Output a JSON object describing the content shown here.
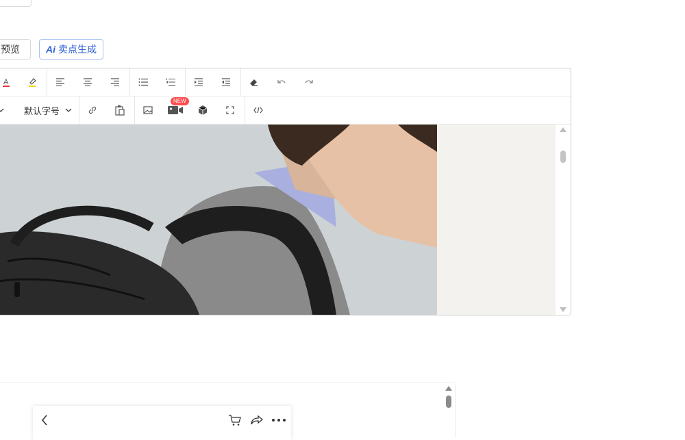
{
  "buttons": {
    "preview_label": "预览",
    "ai_label": "卖点生成",
    "ai_mark": "Ai"
  },
  "toolbar": {
    "font_size_label": "默认字号",
    "new_badge": "NEW",
    "row1_icons": [
      "text-color-icon",
      "highlight-color-icon",
      "align-left-icon",
      "align-center-icon",
      "align-right-icon",
      "bullet-list-icon",
      "numbered-list-icon",
      "indent-icon",
      "outdent-icon",
      "eraser-icon",
      "undo-icon",
      "redo-icon"
    ],
    "row2_icons": [
      "dropdown-chevron-icon",
      "link-icon",
      "paste-icon",
      "image-icon",
      "video-icon",
      "3d-model-icon",
      "fullscreen-icon",
      "code-view-icon"
    ]
  },
  "colors": {
    "accent": "#2f61d5",
    "text_color_red": "#e53935",
    "highlight_yellow": "#f7d117",
    "badge_red": "#ff4d4f"
  },
  "preview": {
    "header_icons": [
      "back-icon",
      "cart-icon",
      "share-icon",
      "more-icon"
    ]
  }
}
